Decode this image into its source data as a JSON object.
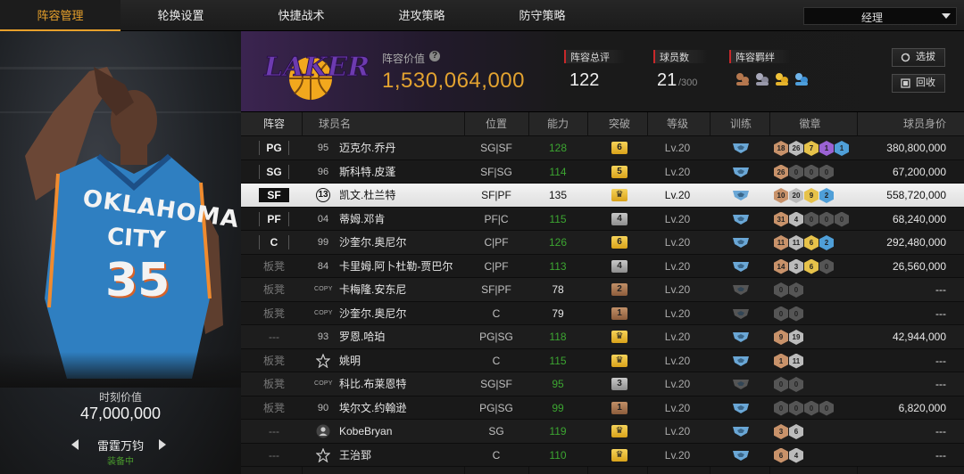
{
  "nav": {
    "tabs": [
      "阵容管理",
      "轮换设置",
      "快捷战术",
      "进攻策略",
      "防守策略"
    ],
    "active_tab": 0,
    "manager_dropdown": "经理"
  },
  "featured_player": {
    "jersey_team_line1": "OKLAHOMA",
    "jersey_team_line2": "CITY",
    "jersey_number": "35",
    "value_label": "时刻价值",
    "value": "47,000,000",
    "skill_name": "雷霆万钧",
    "skill_status": "装备中"
  },
  "team_header": {
    "team_value_label": "阵容价值",
    "team_value": "1,530,064,000",
    "rating_label": "阵容总评",
    "rating": "122",
    "player_count_label": "球员数",
    "player_count": "21",
    "player_count_max": "/300",
    "bond_label": "阵容羁绊",
    "select_button": "选拔",
    "recycle_button": "回收"
  },
  "colors": {
    "accent": "#e7a02b",
    "team_purple": "#552583",
    "team_gold": "#fdb927",
    "ability_green": "#3ca531"
  },
  "table": {
    "headers": [
      "阵容",
      "球员名",
      "位置",
      "能力",
      "突破",
      "等级",
      "训练",
      "徽章",
      "球员身价"
    ],
    "rows": [
      {
        "slot": "PG",
        "bench": false,
        "num": "95",
        "name": "迈克尔.乔丹",
        "pos": "SG|SF",
        "ability": "128",
        "ab_green": true,
        "break": "6",
        "break_color": "gold",
        "level": "Lv.20",
        "badges": [
          "18",
          "26",
          "7",
          "1",
          "1"
        ],
        "badge_colors": [
          "#c8926a",
          "#bbbbbb",
          "#e6c24a",
          "#9a62d3",
          "#4f9fd8"
        ],
        "value": "380,800,000"
      },
      {
        "slot": "SG",
        "bench": false,
        "num": "96",
        "name": "斯科特.皮蓬",
        "pos": "SF|SG",
        "ability": "114",
        "ab_green": true,
        "break": "5",
        "break_color": "gold",
        "level": "Lv.20",
        "badges": [
          "26",
          "0",
          "0",
          "0"
        ],
        "badge_colors": [
          "#c8926a",
          "#555",
          "#555",
          "#555"
        ],
        "value": "67,200,000"
      },
      {
        "slot": "SF",
        "bench": false,
        "selected": true,
        "num": "13",
        "name": "凯文.杜兰特",
        "pos": "SF|PF",
        "ability": "135",
        "ab_green": false,
        "break": "♛",
        "break_color": "gold",
        "level": "Lv.20",
        "badges": [
          "10",
          "20",
          "9",
          "2"
        ],
        "badge_colors": [
          "#c8926a",
          "#bbbbbb",
          "#e6c24a",
          "#4f9fd8"
        ],
        "value": "558,720,000"
      },
      {
        "slot": "PF",
        "bench": false,
        "num": "04",
        "name": "蒂姆.邓肯",
        "pos": "PF|C",
        "ability": "115",
        "ab_green": true,
        "break": "4",
        "break_color": "silver",
        "level": "Lv.20",
        "badges": [
          "31",
          "4",
          "0",
          "0",
          "0"
        ],
        "badge_colors": [
          "#c8926a",
          "#bbbbbb",
          "#555",
          "#555",
          "#555"
        ],
        "value": "68,240,000"
      },
      {
        "slot": "C",
        "bench": false,
        "num": "99",
        "name": "沙奎尔.奥尼尔",
        "pos": "C|PF",
        "ability": "126",
        "ab_green": true,
        "break": "6",
        "break_color": "gold",
        "level": "Lv.20",
        "badges": [
          "11",
          "11",
          "6",
          "2"
        ],
        "badge_colors": [
          "#c8926a",
          "#bbbbbb",
          "#e6c24a",
          "#4f9fd8"
        ],
        "value": "292,480,000"
      },
      {
        "slot": "板凳",
        "bench": true,
        "num": "84",
        "name": "卡里姆.阿卜杜勒-贾巴尔",
        "pos": "C|PF",
        "ability": "113",
        "ab_green": true,
        "break": "4",
        "break_color": "silver",
        "level": "Lv.20",
        "badges": [
          "14",
          "3",
          "6",
          "0"
        ],
        "badge_colors": [
          "#c8926a",
          "#bbbbbb",
          "#e6c24a",
          "#555"
        ],
        "value": "26,560,000"
      },
      {
        "slot": "板凳",
        "bench": true,
        "num": "COPY",
        "name": "卡梅隆.安东尼",
        "pos": "SF|PF",
        "ability": "78",
        "ab_green": false,
        "break": "2",
        "break_color": "bronze",
        "level": "Lv.20",
        "badges": [
          "0",
          "0"
        ],
        "badge_colors": [
          "#555",
          "#555"
        ],
        "value": "---"
      },
      {
        "slot": "板凳",
        "bench": true,
        "num": "COPY",
        "name": "沙奎尔.奥尼尔",
        "pos": "C",
        "ability": "79",
        "ab_green": false,
        "break": "1",
        "break_color": "bronze",
        "level": "Lv.20",
        "badges": [
          "0",
          "0"
        ],
        "badge_colors": [
          "#555",
          "#555"
        ],
        "value": "---"
      },
      {
        "slot": "---",
        "bench": true,
        "num": "93",
        "name": "罗恩.哈珀",
        "pos": "PG|SG",
        "ability": "118",
        "ab_green": true,
        "break": "♛",
        "break_color": "gold",
        "level": "Lv.20",
        "badges": [
          "9",
          "19"
        ],
        "badge_colors": [
          "#c8926a",
          "#bbbbbb"
        ],
        "value": "42,944,000"
      },
      {
        "slot": "板凳",
        "bench": true,
        "num": "STAR",
        "name": "姚明",
        "pos": "C",
        "ability": "115",
        "ab_green": true,
        "break": "♛",
        "break_color": "gold",
        "level": "Lv.20",
        "badges": [
          "1",
          "11"
        ],
        "badge_colors": [
          "#c8926a",
          "#bbbbbb"
        ],
        "value": "---"
      },
      {
        "slot": "板凳",
        "bench": true,
        "num": "COPY",
        "name": "科比.布莱恩特",
        "pos": "SG|SF",
        "ability": "95",
        "ab_green": true,
        "break": "3",
        "break_color": "silver",
        "level": "Lv.20",
        "badges": [
          "0",
          "0"
        ],
        "badge_colors": [
          "#555",
          "#555"
        ],
        "value": "---"
      },
      {
        "slot": "板凳",
        "bench": true,
        "num": "90",
        "name": "埃尔文.约翰逊",
        "pos": "PG|SG",
        "ability": "99",
        "ab_green": true,
        "break": "1",
        "break_color": "bronze",
        "level": "Lv.20",
        "badges": [
          "0",
          "0",
          "0",
          "0"
        ],
        "badge_colors": [
          "#555",
          "#555",
          "#555",
          "#555"
        ],
        "value": "6,820,000"
      },
      {
        "slot": "---",
        "bench": true,
        "num": "USER",
        "name": "KobeBryan",
        "pos": "SG",
        "ability": "119",
        "ab_green": true,
        "break": "♛",
        "break_color": "gold",
        "level": "Lv.20",
        "badges": [
          "3",
          "6"
        ],
        "badge_colors": [
          "#c8926a",
          "#bbbbbb"
        ],
        "value": "---"
      },
      {
        "slot": "---",
        "bench": true,
        "num": "STAR",
        "name": "王治郅",
        "pos": "C",
        "ability": "110",
        "ab_green": true,
        "break": "♛",
        "break_color": "gold",
        "level": "Lv.20",
        "badges": [
          "6",
          "4"
        ],
        "badge_colors": [
          "#c8926a",
          "#bbbbbb"
        ],
        "value": "---"
      }
    ]
  }
}
